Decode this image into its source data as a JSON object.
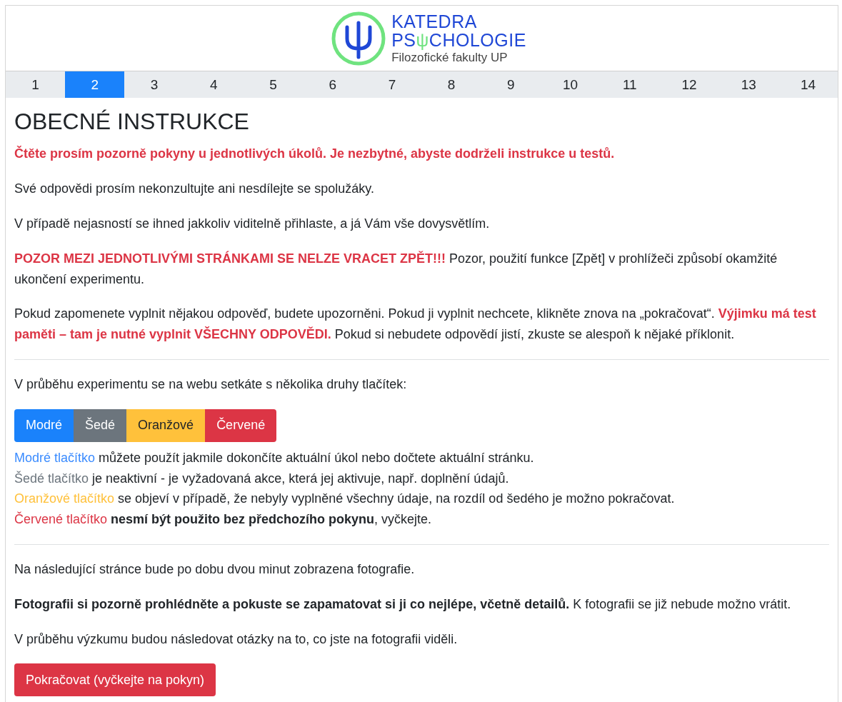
{
  "logo": {
    "line1": "KATEDRA",
    "line2": [
      {
        "text": "PS",
        "kind": "plain"
      },
      {
        "text": "ψ",
        "kind": "accent"
      },
      {
        "text": "CHOLOGIE",
        "kind": "plain"
      }
    ],
    "line3": "Filozofické fakulty UP"
  },
  "steps": [
    {
      "label": "1",
      "selected": false
    },
    {
      "label": "2",
      "selected": true
    },
    {
      "label": "3",
      "selected": false
    },
    {
      "label": "4",
      "selected": false
    },
    {
      "label": "5",
      "selected": false
    },
    {
      "label": "6",
      "selected": false
    },
    {
      "label": "7",
      "selected": false
    },
    {
      "label": "8",
      "selected": false
    },
    {
      "label": "9",
      "selected": false
    },
    {
      "label": "10",
      "selected": false
    },
    {
      "label": "11",
      "selected": false
    },
    {
      "label": "12",
      "selected": false
    },
    {
      "label": "13",
      "selected": false
    },
    {
      "label": "14",
      "selected": false
    }
  ],
  "title": "OBECNÉ INSTRUKCE",
  "blocks": [
    {
      "kind": "para",
      "segments": [
        {
          "text": "Čtěte prosím pozorně pokyny u jednotlivých úkolů. Je nezbytné, abyste dodrželi instrukce u testů.",
          "kind": "alert"
        }
      ]
    },
    {
      "kind": "para",
      "segments": [
        {
          "text": "Své odpovědi prosím nekonzultujte ani nesdílejte se spolužáky.",
          "kind": "plain"
        }
      ]
    },
    {
      "kind": "para",
      "segments": [
        {
          "text": "V případě nejasností se ihned jakkoliv viditelně přihlaste, a já Vám vše dovysvětlím.",
          "kind": "plain"
        }
      ]
    },
    {
      "kind": "para",
      "segments": [
        {
          "text": "POZOR MEZI JEDNOTLIVÝMI STRÁNKAMI SE NELZE VRACET ZPĚT!!!",
          "kind": "alert"
        },
        {
          "text": " Pozor, použití funkce [Zpět] v prohlížeči způsobí okamžité ukončení experimentu.",
          "kind": "plain"
        }
      ]
    },
    {
      "kind": "para",
      "segments": [
        {
          "text": "Pokud zapomenete vyplnit nějakou odpověď, budete upozorněni. Pokud ji vyplnit nechcete, klikněte znova na „pokračovat“. ",
          "kind": "plain"
        },
        {
          "text": "Výjimku má test paměti – tam je nutné vyplnit VŠECHNY ODPOVĚDI.",
          "kind": "alert"
        },
        {
          "text": " Pokud si nebudete odpovědí jistí, zkuste se alespoň k nějaké příklonit.",
          "kind": "plain"
        }
      ]
    },
    {
      "kind": "divider"
    },
    {
      "kind": "para",
      "segments": [
        {
          "text": "V průběhu experimentu se na webu setkáte s několika druhy tlačítek:",
          "kind": "plain"
        }
      ]
    },
    {
      "kind": "buttons",
      "buttons": [
        {
          "label": "Modré",
          "kind": "primary"
        },
        {
          "label": "Šedé",
          "kind": "secondary"
        },
        {
          "label": "Oranžové",
          "kind": "warning"
        },
        {
          "label": "Červené",
          "kind": "danger"
        }
      ]
    },
    {
      "kind": "line",
      "segments": [
        {
          "text": "Modré tlačítko",
          "kind": "blue"
        },
        {
          "text": " můžete použít jakmile dokončíte aktuální úkol nebo dočtete aktuální stránku.",
          "kind": "plain"
        }
      ]
    },
    {
      "kind": "line",
      "segments": [
        {
          "text": "Šedé tlačítko",
          "kind": "gray"
        },
        {
          "text": " je neaktivní - je vyžadovaná akce, která jej aktivuje, např. doplnění údajů.",
          "kind": "plain"
        }
      ]
    },
    {
      "kind": "line",
      "segments": [
        {
          "text": "Oranžové tlačítko",
          "kind": "orange"
        },
        {
          "text": " se objeví v případě, že nebyly vyplněné všechny údaje, na rozdíl od šedého je možno pokračovat.",
          "kind": "plain"
        }
      ]
    },
    {
      "kind": "line",
      "segments": [
        {
          "text": "Červené tlačítko",
          "kind": "red"
        },
        {
          "text": " nesmí být použito bez předchozího pokynu",
          "kind": "bold"
        },
        {
          "text": ", vyčkejte.",
          "kind": "plain"
        }
      ]
    },
    {
      "kind": "divider"
    },
    {
      "kind": "para",
      "segments": [
        {
          "text": "Na následující stránce bude po dobu dvou minut zobrazena fotografie.",
          "kind": "plain"
        }
      ]
    },
    {
      "kind": "para",
      "segments": [
        {
          "text": "Fotografii si pozorně prohlédněte a pokuste se zapamatovat si ji co nejlépe, včetně detailů.",
          "kind": "bold"
        },
        {
          "text": " K fotografii se již nebude možno vrátit.",
          "kind": "plain"
        }
      ]
    },
    {
      "kind": "para",
      "segments": [
        {
          "text": "V průběhu výzkumu budou následovat otázky na to, co jste na fotografii viděli.",
          "kind": "plain"
        }
      ]
    }
  ],
  "continue_button": {
    "label": "Pokračovat (vyčkejte na pokyn)",
    "kind": "danger"
  }
}
